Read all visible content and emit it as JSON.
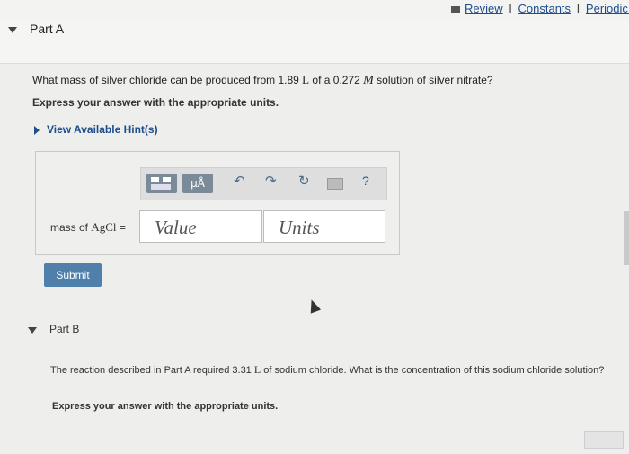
{
  "top_links": {
    "review": "Review",
    "constants": "Constants",
    "periodic": "Periodic Ta",
    "sep": "I"
  },
  "partA": {
    "label": "Part A",
    "question_pre": "What mass of silver chloride can be produced from 1.89 ",
    "unit_L": "L",
    "question_mid": " of a 0.272 ",
    "unit_M": "M",
    "question_post": " solution of silver nitrate?",
    "express": "Express your answer with the appropriate units.",
    "hint": "View Available Hint(s)",
    "toolbar": {
      "mu_label": "μÅ",
      "undo": "↶",
      "redo": "↷",
      "reset": "↻",
      "help": "?"
    },
    "answer_label_pre": "mass of ",
    "answer_formula": "AgCl",
    "answer_label_post": " =",
    "value_placeholder": "Value",
    "units_placeholder": "Units",
    "submit": "Submit"
  },
  "partB": {
    "label": "Part B",
    "text_pre": "The reaction described in Part A required 3.31 ",
    "unit_L": "L",
    "text_post": " of sodium chloride. What is the concentration of this sodium chloride solution?",
    "express": "Express your answer with the appropriate units."
  }
}
